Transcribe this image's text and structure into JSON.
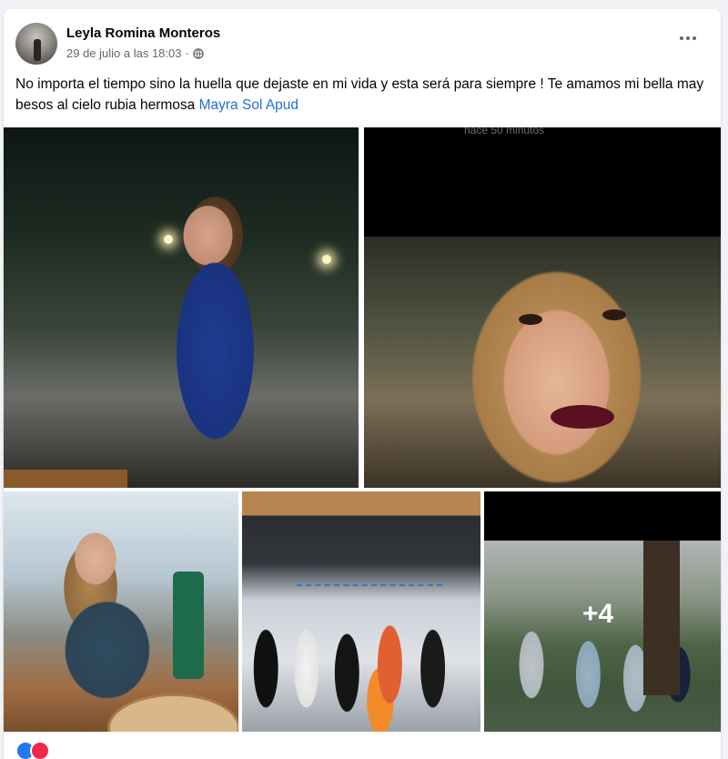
{
  "post": {
    "author": "Leyla Romina Monteros",
    "date": "29 de julio a las 18:03",
    "separator": "·",
    "privacy_icon": "globe-icon",
    "more_icon": "more-options-icon",
    "caption_text": "No importa el tiempo sino la huella que dejaste en mi vida y esta será para siempre ! Te amamos mi bella may besos al cielo rubia hermosa ",
    "mention": "Mayra Sol Apud"
  },
  "photos": {
    "screenshot_text": "hace 50 minutos",
    "more_count": "+4"
  },
  "colors": {
    "mention": "#216fdb",
    "meta": "#65676b",
    "background": "#f0f2f5"
  }
}
